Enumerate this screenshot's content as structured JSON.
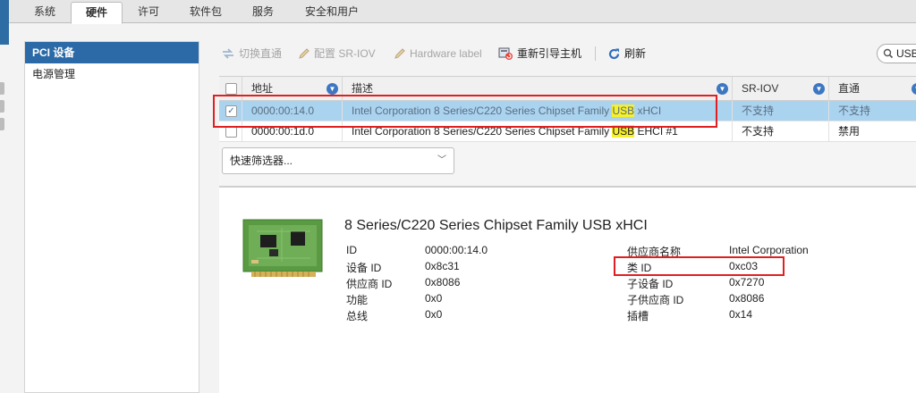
{
  "tabs": [
    {
      "label": "系统"
    },
    {
      "label": "硬件"
    },
    {
      "label": "许可"
    },
    {
      "label": "软件包"
    },
    {
      "label": "服务"
    },
    {
      "label": "安全和用户"
    }
  ],
  "nav": {
    "items": [
      {
        "label": "PCI 设备",
        "selected": true
      },
      {
        "label": "电源管理",
        "selected": false
      }
    ]
  },
  "toolbar": {
    "toggle_passthrough": "切换直通",
    "config_sriov": "配置 SR-IOV",
    "hardware_label": "Hardware label",
    "reboot_host": "重新引导主机",
    "refresh": "刷新"
  },
  "search": {
    "value": "USB"
  },
  "grid": {
    "columns": {
      "address": "地址",
      "description": "描述",
      "sriov": "SR-IOV",
      "passthrough": "直通"
    },
    "rows": [
      {
        "checked": true,
        "address": "0000:00:14.0",
        "desc_prefix": "Intel Corporation 8 Series/C220 Series Chipset Family ",
        "desc_highlight": "USB",
        "desc_suffix": " xHCI",
        "sriov": "不支持",
        "passthrough": "不支持"
      },
      {
        "checked": false,
        "address": "0000:00:1d.0",
        "desc_prefix": "Intel Corporation 8 Series/C220 Series Chipset Family ",
        "desc_highlight": "USB",
        "desc_suffix": " EHCI #1",
        "sriov": "不支持",
        "passthrough": "禁用"
      }
    ],
    "quick_filter": "快速筛选器..."
  },
  "detail": {
    "title": "8 Series/C220 Series Chipset Family USB xHCI",
    "left": [
      {
        "label": "ID",
        "value": "0000:00:14.0"
      },
      {
        "label": "设备 ID",
        "value": "0x8c31"
      },
      {
        "label": "供应商 ID",
        "value": "0x8086"
      },
      {
        "label": "功能",
        "value": "0x0"
      },
      {
        "label": "总线",
        "value": "0x0"
      }
    ],
    "right": [
      {
        "label": "供应商名称",
        "value": "Intel Corporation"
      },
      {
        "label": "类 ID",
        "value": "0xc03"
      },
      {
        "label": "子设备 ID",
        "value": "0x7270"
      },
      {
        "label": "子供应商 ID",
        "value": "0x8086"
      },
      {
        "label": "插槽",
        "value": "0x14"
      }
    ]
  },
  "colors": {
    "accent": "#2b6aa7",
    "selected_row": "#aad3f0",
    "highlight": "#f7f02a",
    "annotation": "#e02020"
  }
}
